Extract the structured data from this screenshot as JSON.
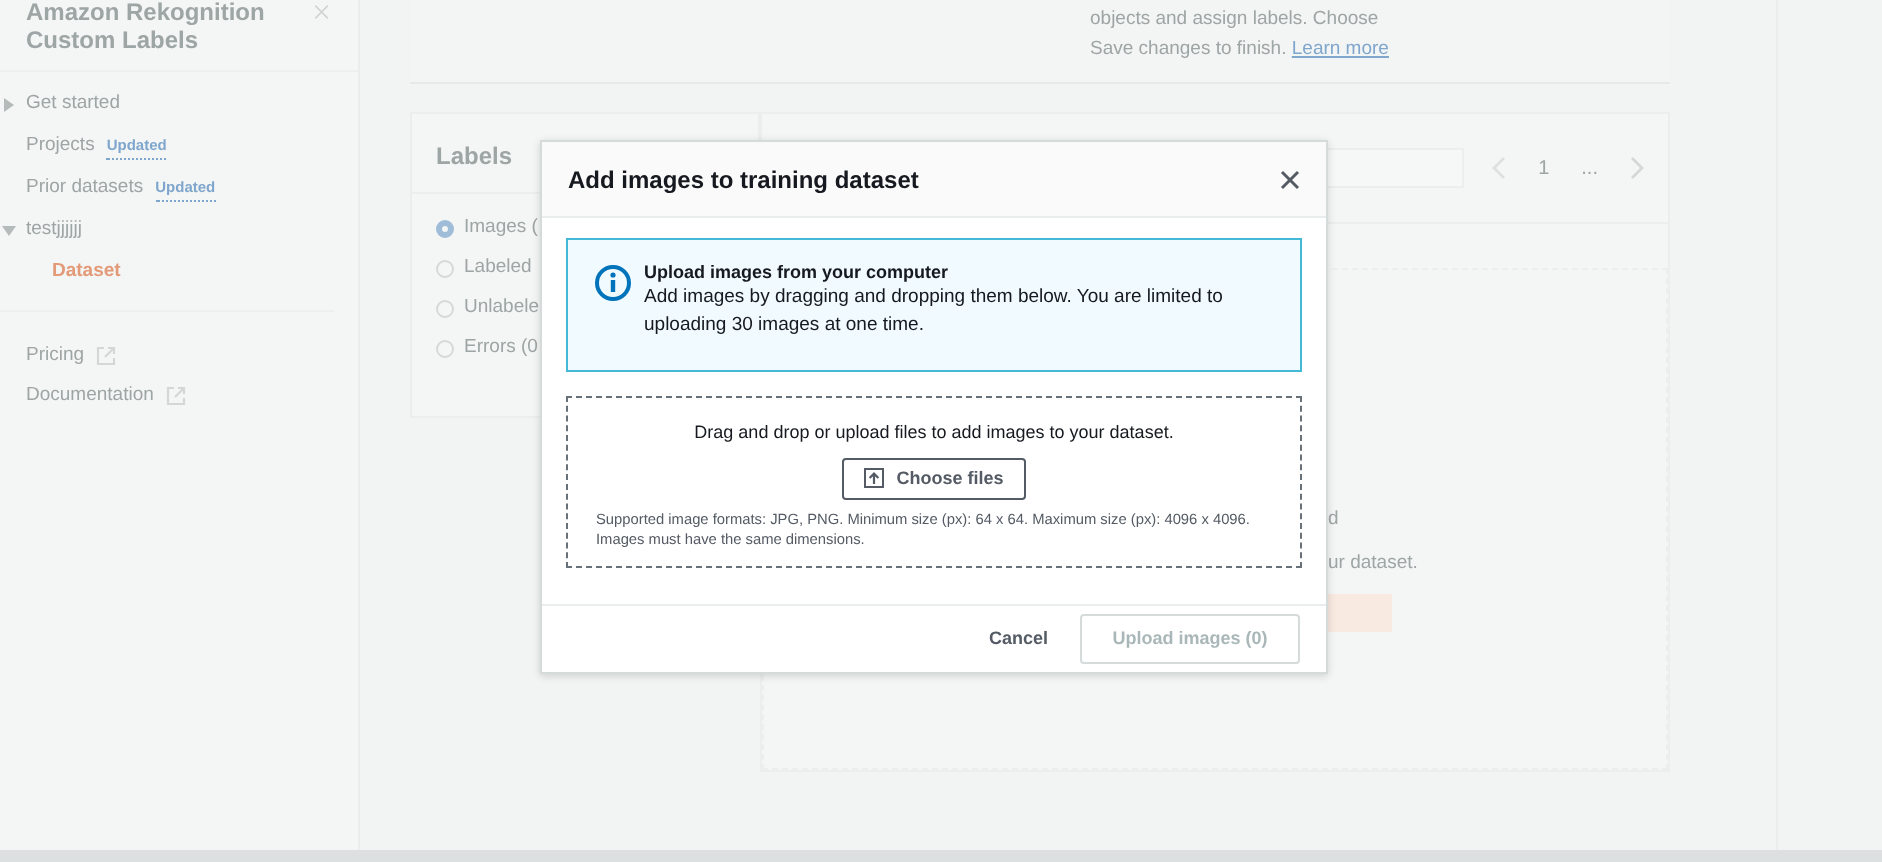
{
  "sidebar": {
    "title": "Amazon Rekognition Custom Labels",
    "items": [
      {
        "label": "Get started",
        "kind": "section",
        "expanded": false
      },
      {
        "label": "Projects",
        "kind": "link",
        "badge": "Updated"
      },
      {
        "label": "Prior datasets",
        "kind": "link",
        "badge": "Updated"
      },
      {
        "label": "testjjjjjj",
        "kind": "section",
        "expanded": true,
        "children": [
          {
            "label": "Dataset",
            "selected": true
          }
        ]
      }
    ],
    "links": [
      {
        "label": "Pricing"
      },
      {
        "label": "Documentation"
      }
    ]
  },
  "intro": {
    "line_1": "objects and assign labels. Choose",
    "line_2": "Save changes to finish.",
    "link": "Learn more"
  },
  "labels_panel": {
    "title": "Labels",
    "filters": [
      {
        "label": "Images (",
        "selected": true
      },
      {
        "label": "Labeled",
        "selected": false
      },
      {
        "label": "Unlabele",
        "selected": false
      },
      {
        "label": "Errors (0",
        "selected": false
      }
    ]
  },
  "images_panel": {
    "page": "1",
    "ellipsis": "...",
    "empty_line_1": "d",
    "empty_line_2": "ur dataset."
  },
  "modal": {
    "title": "Add images to training dataset",
    "info": {
      "heading": "Upload images from your computer",
      "text": "Add images by dragging and dropping them below. You are limited to uploading 30 images at one time."
    },
    "dropzone": {
      "prompt": "Drag and drop or upload files to add images to your dataset.",
      "button": "Choose files",
      "hint": "Supported image formats: JPG, PNG. Minimum size (px): 64 x 64. Maximum size (px): 4096 x 4096. Images must have the same dimensions."
    },
    "buttons": [
      {
        "label": "Cancel",
        "kind": "link"
      },
      {
        "label": "Upload images (0)",
        "kind": "primary",
        "disabled": true
      }
    ]
  }
}
